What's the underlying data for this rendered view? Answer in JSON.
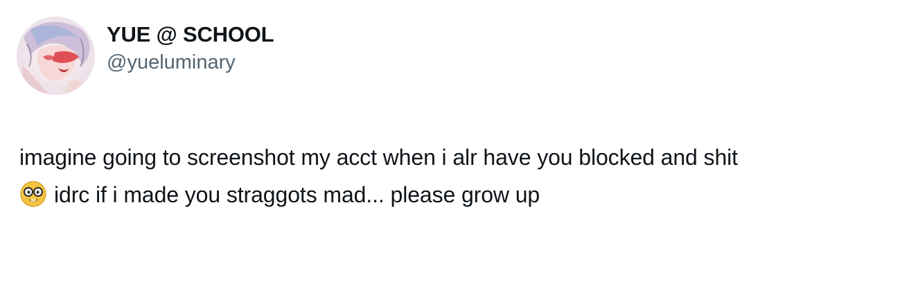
{
  "post": {
    "author": {
      "display_name": "YUE @ SCHOOL",
      "handle": "@yueluminary",
      "avatar_icon": "anime-avatar-image"
    },
    "text": {
      "line_1": "imagine going to screenshot my acct when i alr have you blocked and shit",
      "emoji_icon": "nerd-face-emoji",
      "line_2": "idrc if i made you straggots mad... please grow up"
    }
  },
  "colors": {
    "text_primary": "#0f1419",
    "text_secondary": "#536471",
    "background": "#ffffff"
  }
}
